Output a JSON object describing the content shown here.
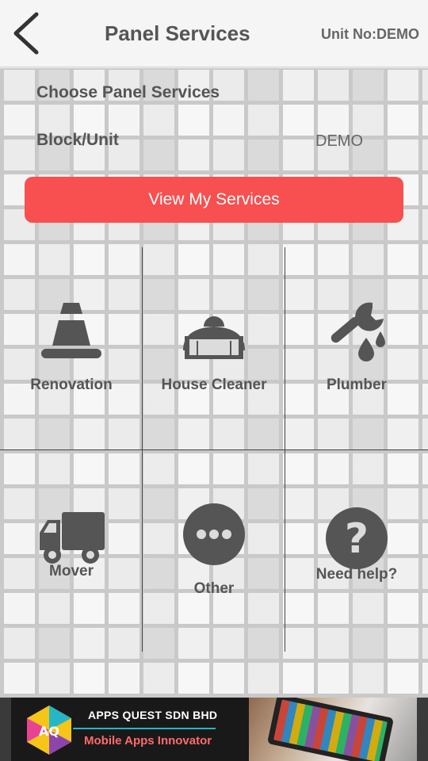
{
  "header": {
    "title": "Panel Services",
    "unit_text": "Unit No:DEMO"
  },
  "form": {
    "choose_label": "Choose Panel Services",
    "block_label": "Block/Unit",
    "block_value": "DEMO",
    "view_button": "View My Services"
  },
  "services": [
    {
      "label": "Renovation",
      "icon": "traffic-cone-icon"
    },
    {
      "label": "House Cleaner",
      "icon": "brush-icon"
    },
    {
      "label": "Plumber",
      "icon": "wrench-water-icon"
    },
    {
      "label": "Mover",
      "icon": "truck-icon"
    },
    {
      "label": "Other",
      "icon": "more-dots-icon"
    },
    {
      "label": "Need help?",
      "icon": "question-icon"
    }
  ],
  "ad": {
    "logo_text": "AQ",
    "company": "APPS QUEST SDN BHD",
    "tagline": "Mobile Apps Innovator"
  },
  "colors": {
    "accent": "#f84f50",
    "icon": "#555555"
  }
}
